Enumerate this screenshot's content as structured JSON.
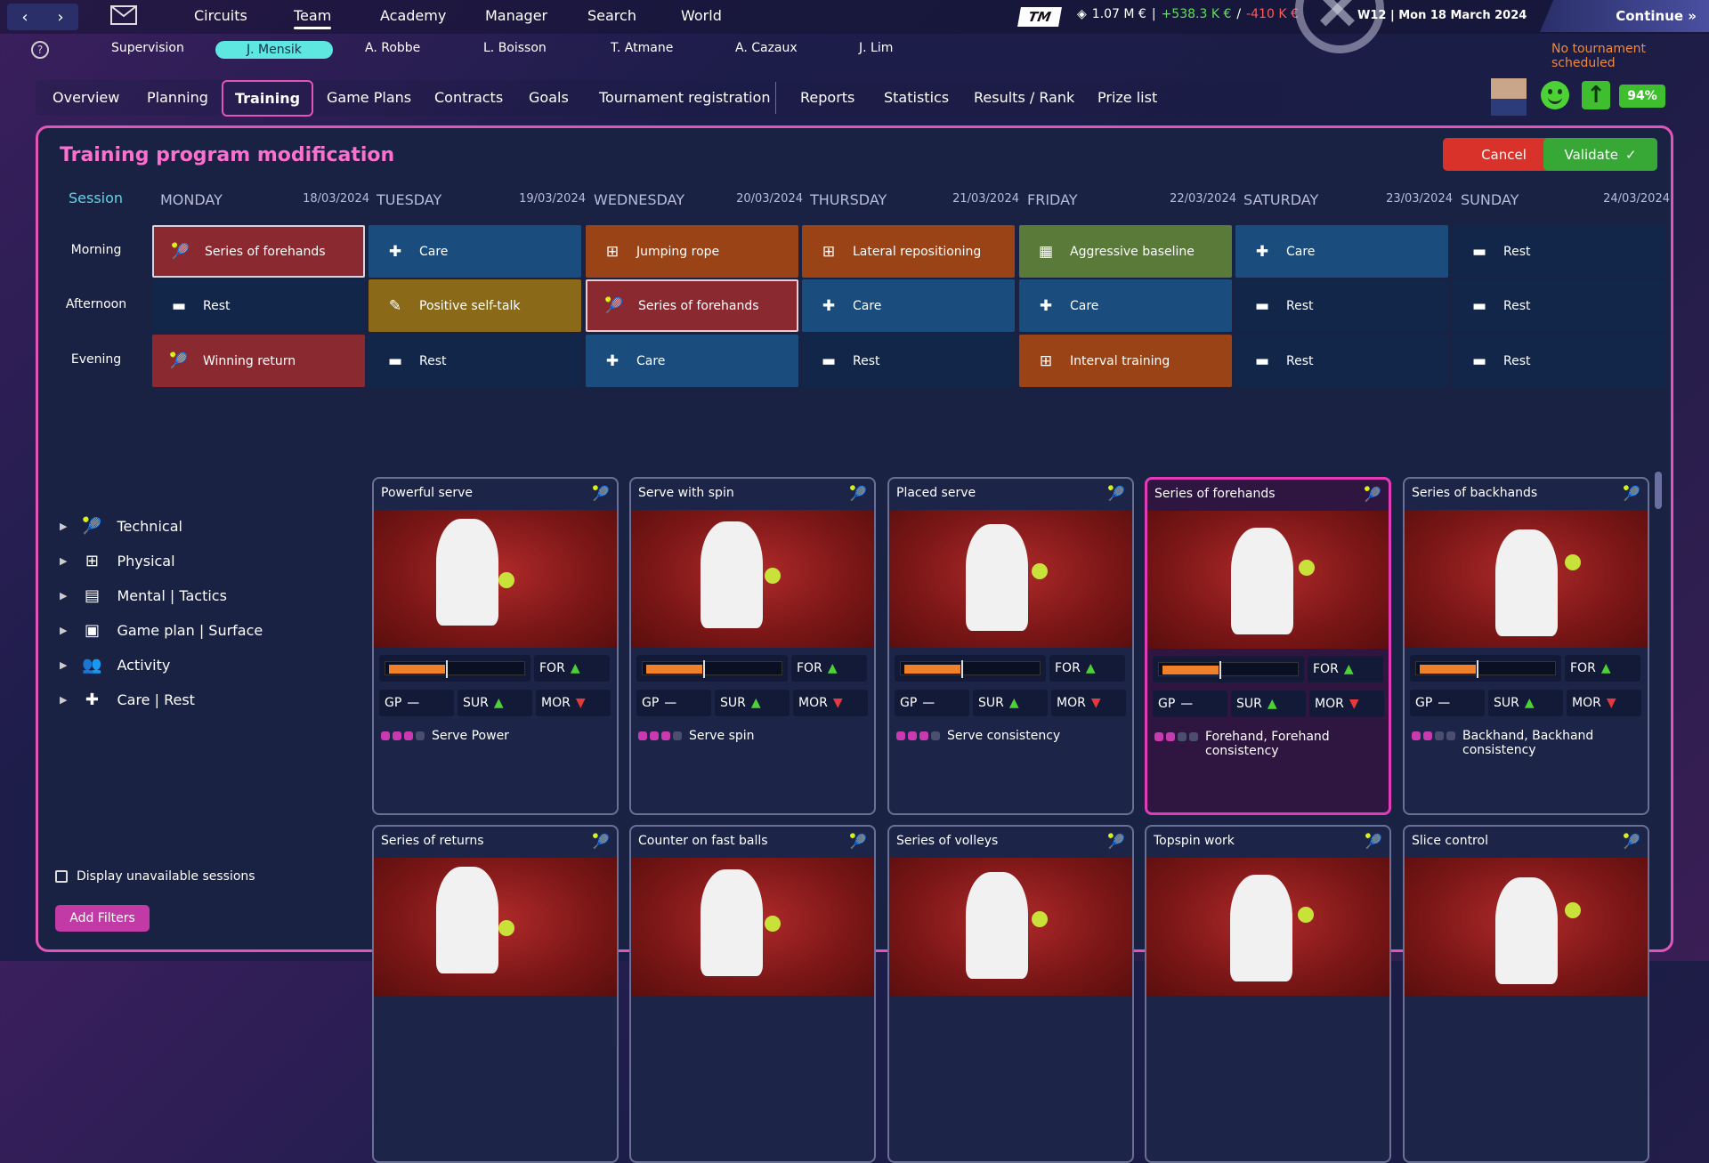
{
  "topbar": {
    "nav": [
      "Circuits",
      "Team",
      "Academy",
      "Manager",
      "Search",
      "World"
    ],
    "active": "Team",
    "logo": "TM",
    "balance": "1.07 M €",
    "income": "+538.3 K €",
    "expense": "-410 K €",
    "date": "W12 | Mon 18 March 2024",
    "continue": "Continue"
  },
  "players": [
    "Supervision",
    "J. Mensik",
    "A. Robbe",
    "L. Boisson",
    "T. Atmane",
    "A. Cazaux",
    "J. Lim"
  ],
  "no_tournament": "No tournament scheduled",
  "tabs": [
    "Overview",
    "Planning",
    "Training",
    "Game Plans",
    "Contracts",
    "Goals",
    "Tournament registration",
    "Reports",
    "Statistics",
    "Results / Rank",
    "Prize list"
  ],
  "status_pct": "94%",
  "panel": {
    "title": "Training program modification",
    "cancel": "Cancel",
    "validate": "Validate",
    "session_label": "Session"
  },
  "days": [
    {
      "name": "MONDAY",
      "date": "18/03/2024"
    },
    {
      "name": "TUESDAY",
      "date": "19/03/2024"
    },
    {
      "name": "WEDNESDAY",
      "date": "20/03/2024"
    },
    {
      "name": "THURSDAY",
      "date": "21/03/2024"
    },
    {
      "name": "FRIDAY",
      "date": "22/03/2024"
    },
    {
      "name": "SATURDAY",
      "date": "23/03/2024"
    },
    {
      "name": "SUNDAY",
      "date": "24/03/2024"
    }
  ],
  "sessions": [
    "Morning",
    "Afternoon",
    "Evening"
  ],
  "schedule": [
    [
      {
        "label": "Series of forehands",
        "type": "tech",
        "sel": true
      },
      {
        "label": "Care",
        "type": "care"
      },
      {
        "label": "Jumping rope",
        "type": "phys"
      },
      {
        "label": "Lateral repositioning",
        "type": "phys"
      },
      {
        "label": "Aggressive baseline",
        "type": "game"
      },
      {
        "label": "Care",
        "type": "care"
      },
      {
        "label": "Rest",
        "type": "rest"
      }
    ],
    [
      {
        "label": "Rest",
        "type": "rest"
      },
      {
        "label": "Positive self-talk",
        "type": "mental"
      },
      {
        "label": "Series of forehands",
        "type": "tech",
        "sel": true
      },
      {
        "label": "Care",
        "type": "care"
      },
      {
        "label": "Care",
        "type": "care"
      },
      {
        "label": "Rest",
        "type": "rest"
      },
      {
        "label": "Rest",
        "type": "rest"
      }
    ],
    [
      {
        "label": "Winning return",
        "type": "tech"
      },
      {
        "label": "Rest",
        "type": "rest"
      },
      {
        "label": "Care",
        "type": "care"
      },
      {
        "label": "Rest",
        "type": "rest"
      },
      {
        "label": "Interval training",
        "type": "phys"
      },
      {
        "label": "Rest",
        "type": "rest"
      },
      {
        "label": "Rest",
        "type": "rest"
      }
    ]
  ],
  "filters": [
    "Technical",
    "Physical",
    "Mental | Tactics",
    "Game plan | Surface",
    "Activity",
    "Care | Rest"
  ],
  "display_unavailable": "Display unavailable sessions",
  "add_filters": "Add Filters",
  "stat_labels": {
    "for": "FOR",
    "gp": "GP",
    "sur": "SUR",
    "mor": "MOR"
  },
  "cards": [
    {
      "title": "Powerful serve",
      "skill": "Serve Power",
      "level": 3,
      "load": 0.45
    },
    {
      "title": "Serve with spin",
      "skill": "Serve spin",
      "level": 3,
      "load": 0.45
    },
    {
      "title": "Placed serve",
      "skill": "Serve consistency",
      "level": 3,
      "load": 0.45
    },
    {
      "title": "Series of forehands",
      "skill": "Forehand, Forehand consistency",
      "level": 2,
      "load": 0.45,
      "hl": true
    },
    {
      "title": "Series of backhands",
      "skill": "Backhand, Backhand consistency",
      "level": 2,
      "load": 0.45
    },
    {
      "title": "Series of returns"
    },
    {
      "title": "Counter on fast balls"
    },
    {
      "title": "Series of volleys"
    },
    {
      "title": "Topspin work"
    },
    {
      "title": "Slice control"
    }
  ]
}
